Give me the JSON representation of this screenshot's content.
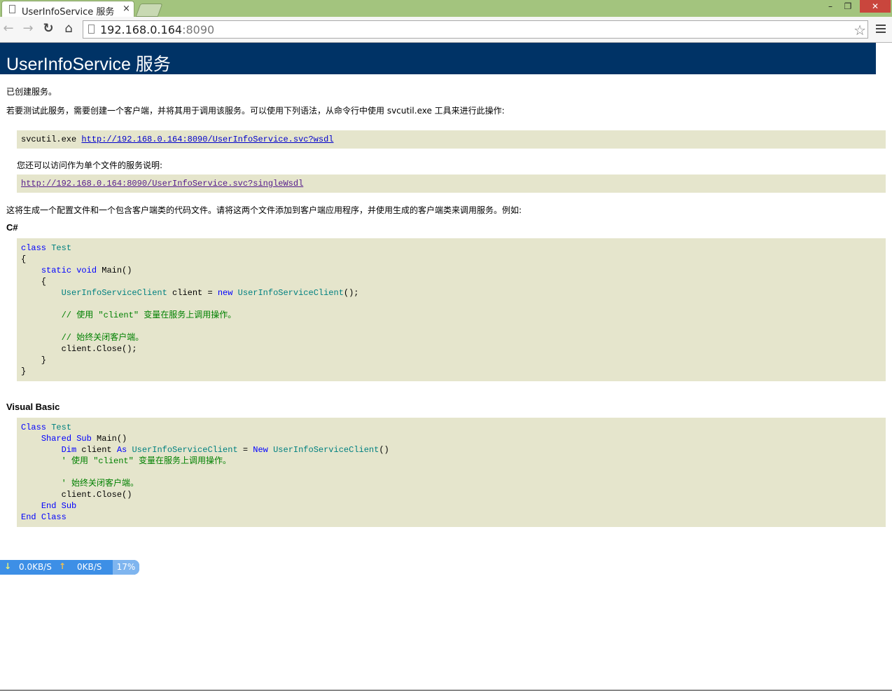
{
  "browser": {
    "tab_title": "UserInfoService 服务",
    "tab_close": "×",
    "window_minimize": "–",
    "window_maximize": "❐",
    "window_close": "✕",
    "back": "←",
    "forward": "→",
    "reload": "↻",
    "home": "⌂",
    "url_host": "192.168.0.164",
    "url_port": ":8090",
    "bookmark_star": "☆"
  },
  "page": {
    "title": "UserInfoService 服务",
    "created": "已创建服务。",
    "intro": "若要测试此服务，需要创建一个客户端，并将其用于调用该服务。可以使用下列语法，从命令行中使用 svcutil.exe 工具来进行此操作:",
    "svcutil_cmd": "svcutil.exe ",
    "wsdl_link": "http://192.168.0.164:8090/UserInfoService.svc?wsdl",
    "single_file_text": "您还可以访问作为单个文件的服务说明:",
    "single_wsdl_link": "http://192.168.0.164:8090/UserInfoService.svc?singleWsdl",
    "generate_text": "这将生成一个配置文件和一个包含客户端类的代码文件。请将这两个文件添加到客户端应用程序，并使用生成的客户端类来调用服务。例如:",
    "csharp_heading": "C#",
    "vb_heading": "Visual Basic"
  },
  "speed_widget": {
    "down_arrow": "↓",
    "down_value": "0.0KB/S",
    "up_arrow": "↑",
    "up_value": "0KB/S",
    "percent": "17%"
  }
}
